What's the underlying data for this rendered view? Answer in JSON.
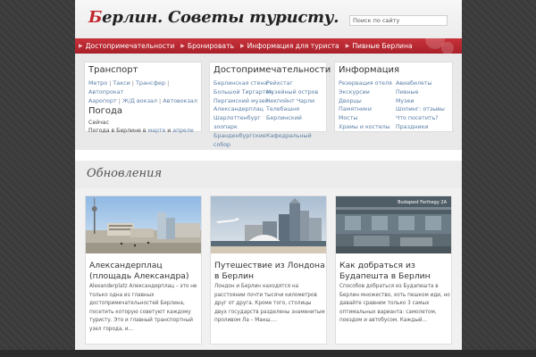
{
  "header": {
    "logo_first": "Б",
    "logo_rest": "ерлин. Советы туристу.",
    "search_placeholder": "Поиск по сайту"
  },
  "nav": {
    "items": [
      {
        "label": "Достопримечательности"
      },
      {
        "label": "Бронировать"
      },
      {
        "label": "Информация для туриста"
      },
      {
        "label": "Пивные Берлина"
      }
    ]
  },
  "transport": {
    "title": "Транспорт",
    "links": [
      "Метро",
      "Такси",
      "Трансфер",
      "Автопрокат",
      "Аэропорт",
      "Ж/Д вокзал",
      "Автовокзал"
    ],
    "sep": "|",
    "weather_title": "Погода",
    "weather_now": "Сейчас",
    "weather_text": "Погода в Берлине в",
    "weather_march": "марте",
    "weather_and": "и",
    "weather_april": "апреле"
  },
  "sights": {
    "title": "Достопримечательности",
    "col1": [
      "Берлинская стена",
      "Большой Тиргартен",
      "Пергамский музей",
      "Александерплац",
      "Шарлоттенбург",
      "зоопарк",
      "Бранденбургские",
      "собор"
    ],
    "col2": [
      "Рейхстаг",
      "Музейный остров",
      "Чекпойнт Чарли",
      "Телебашня",
      "Берлинский",
      "",
      "Кафедральный",
      ""
    ]
  },
  "info": {
    "title": "Информация",
    "col1": [
      "Резервация отеля",
      "Экскурсии",
      "Дворцы",
      "Памятники",
      "Мосты",
      "Храмы и костелы"
    ],
    "col2": [
      "Авиабилеты",
      "Пивные",
      "Музеи",
      "Шопинг: отзывы",
      "Что посетить?",
      "Праздники"
    ]
  },
  "updates": {
    "title": "Обновления"
  },
  "posts": [
    {
      "title": "Александерплац (площадь Александра)",
      "excerpt": "Alexanderplatz Александерплац – это не только одна из главных достопримечательностей Берлина, посетить которую советуют каждому туристу. Это и главный транспортный узел города, и…"
    },
    {
      "title": "Путешествие из Лондона в Берлин",
      "excerpt": "Лондон и Берлин находятся на расстоянии почти тысячи километров друг от друга. Кроме того, столицы двух государств разделены знаменитым проливом Ла – Манш…."
    },
    {
      "title": "Как добраться из Будапешта в Берлин",
      "excerpt": "Способов добраться из Будапешта в Берлин множество, хоть пешком иди, но давайте сравним только 3 самых оптимальных варианта: самолетом, поездом и автобусом. Каждый…",
      "image_sign": "Budapest Ferihegy 2A"
    }
  ],
  "colors": {
    "accent": "#c0262c",
    "link": "#5b7fa6",
    "nav": "#b8252f"
  }
}
